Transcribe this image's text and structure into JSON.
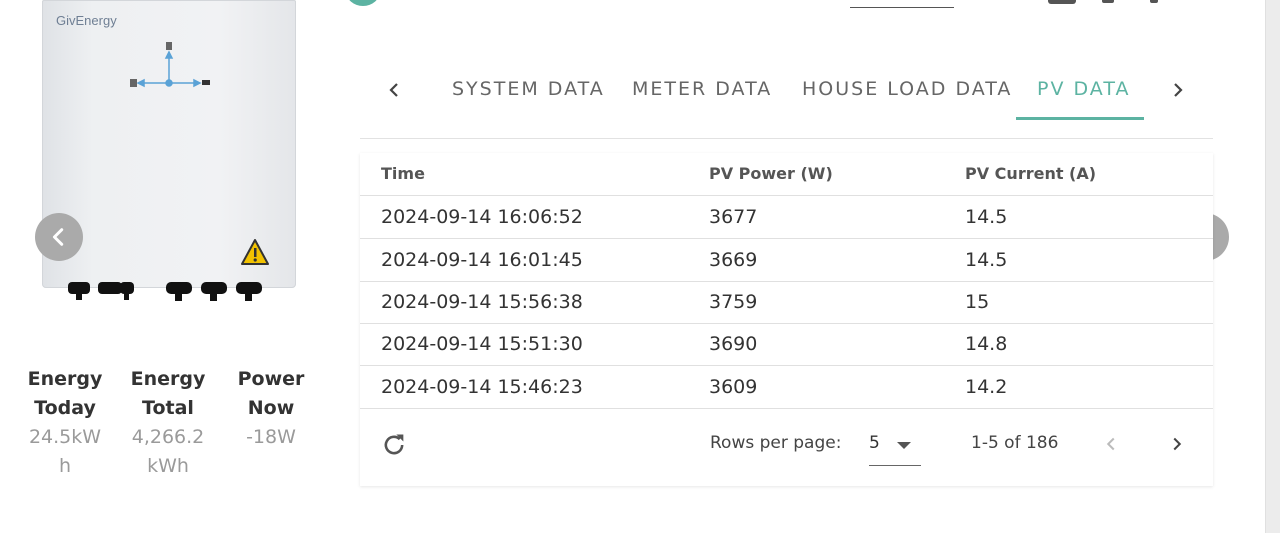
{
  "device": {
    "brand": "GivEnergy"
  },
  "stats": [
    {
      "label": "Energy Today",
      "value": "24.5kWh"
    },
    {
      "label": "Energy Total",
      "value": "4,266.2kWh"
    },
    {
      "label": "Power Now",
      "value": "-18W"
    }
  ],
  "tabs": [
    {
      "label": "SYSTEM DATA"
    },
    {
      "label": "METER DATA"
    },
    {
      "label": "HOUSE LOAD DATA"
    },
    {
      "label": "PV DATA",
      "active": true
    }
  ],
  "table": {
    "headers": [
      "Time",
      "PV Power (W)",
      "PV Current (A)"
    ],
    "rows": [
      [
        "2024-09-14 16:06:52",
        "3677",
        "14.5"
      ],
      [
        "2024-09-14 16:01:45",
        "3669",
        "14.5"
      ],
      [
        "2024-09-14 15:56:38",
        "3759",
        "15"
      ],
      [
        "2024-09-14 15:51:30",
        "3690",
        "14.8"
      ],
      [
        "2024-09-14 15:46:23",
        "3609",
        "14.2"
      ]
    ]
  },
  "pagination": {
    "rows_per_page_label": "Rows per page:",
    "rows_per_page": "5",
    "range": "1-5 of 186"
  },
  "colors": {
    "accent": "#5cb3a2",
    "carousel_button": "#aaaaaa"
  }
}
